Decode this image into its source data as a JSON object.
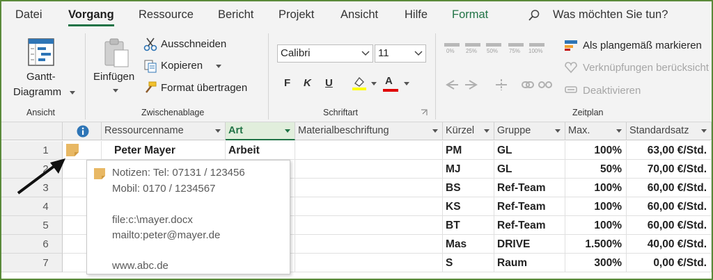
{
  "menu": {
    "tabs": [
      "Datei",
      "Vorgang",
      "Ressource",
      "Bericht",
      "Projekt",
      "Ansicht",
      "Hilfe",
      "Format"
    ],
    "search_placeholder": "Was möchten Sie tun?"
  },
  "ribbon": {
    "ansicht": {
      "gantt_line1": "Gantt-",
      "gantt_line2": "Diagramm",
      "label": "Ansicht"
    },
    "clipboard": {
      "paste": "Einfügen",
      "cut": "Ausschneiden",
      "copy": "Kopieren",
      "format_painter": "Format übertragen",
      "label": "Zwischenablage"
    },
    "font": {
      "name": "Calibri",
      "size": "11",
      "bold": "F",
      "italic": "K",
      "underline": "U",
      "highlight": "A",
      "label": "Schriftart"
    },
    "schedule": {
      "percent_buttons": [
        "0%",
        "25%",
        "50%",
        "75%",
        "100%"
      ],
      "mark_on_track": "Als plangemäß markieren",
      "respect_links": "Verknüpfungen berücksicht",
      "deactivate": "Deaktivieren",
      "label": "Zeitplan"
    }
  },
  "grid": {
    "columns": [
      "Ressourcenname",
      "Art",
      "Materialbeschriftung",
      "Kürzel",
      "Gruppe",
      "Max.",
      "Standardsatz"
    ],
    "rows": [
      {
        "num": "1",
        "name": "Peter Mayer",
        "type": "Arbeit",
        "initials": "PM",
        "group": "GL",
        "max": "100%",
        "rate": "63,00 €/Std."
      },
      {
        "num": "2",
        "name": "",
        "type": "",
        "initials": "MJ",
        "group": "GL",
        "max": "50%",
        "rate": "70,00 €/Std."
      },
      {
        "num": "3",
        "name": "",
        "type": "",
        "initials": "BS",
        "group": "Ref-Team",
        "max": "100%",
        "rate": "60,00 €/Std."
      },
      {
        "num": "4",
        "name": "",
        "type": "",
        "initials": "KS",
        "group": "Ref-Team",
        "max": "100%",
        "rate": "60,00 €/Std."
      },
      {
        "num": "5",
        "name": "",
        "type": "",
        "initials": "BT",
        "group": "Ref-Team",
        "max": "100%",
        "rate": "60,00 €/Std."
      },
      {
        "num": "6",
        "name": "",
        "type": "",
        "initials": "Mas",
        "group": "DRIVE",
        "max": "1.500%",
        "rate": "40,00 €/Std."
      },
      {
        "num": "7",
        "name": "",
        "type": "",
        "initials": "S",
        "group": "Raum",
        "max": "300%",
        "rate": "0,00 €/Std."
      }
    ]
  },
  "tooltip": {
    "lines": [
      "Notizen: Tel: 07131 / 123456",
      "Mobil: 0170 / 1234567",
      "file:c:\\mayer.docx",
      "mailto:peter@mayer.de",
      "www.abc.de"
    ]
  },
  "colors": {
    "accent": "#217346",
    "frame": "#5a8a3a",
    "note": "#e8b864"
  }
}
